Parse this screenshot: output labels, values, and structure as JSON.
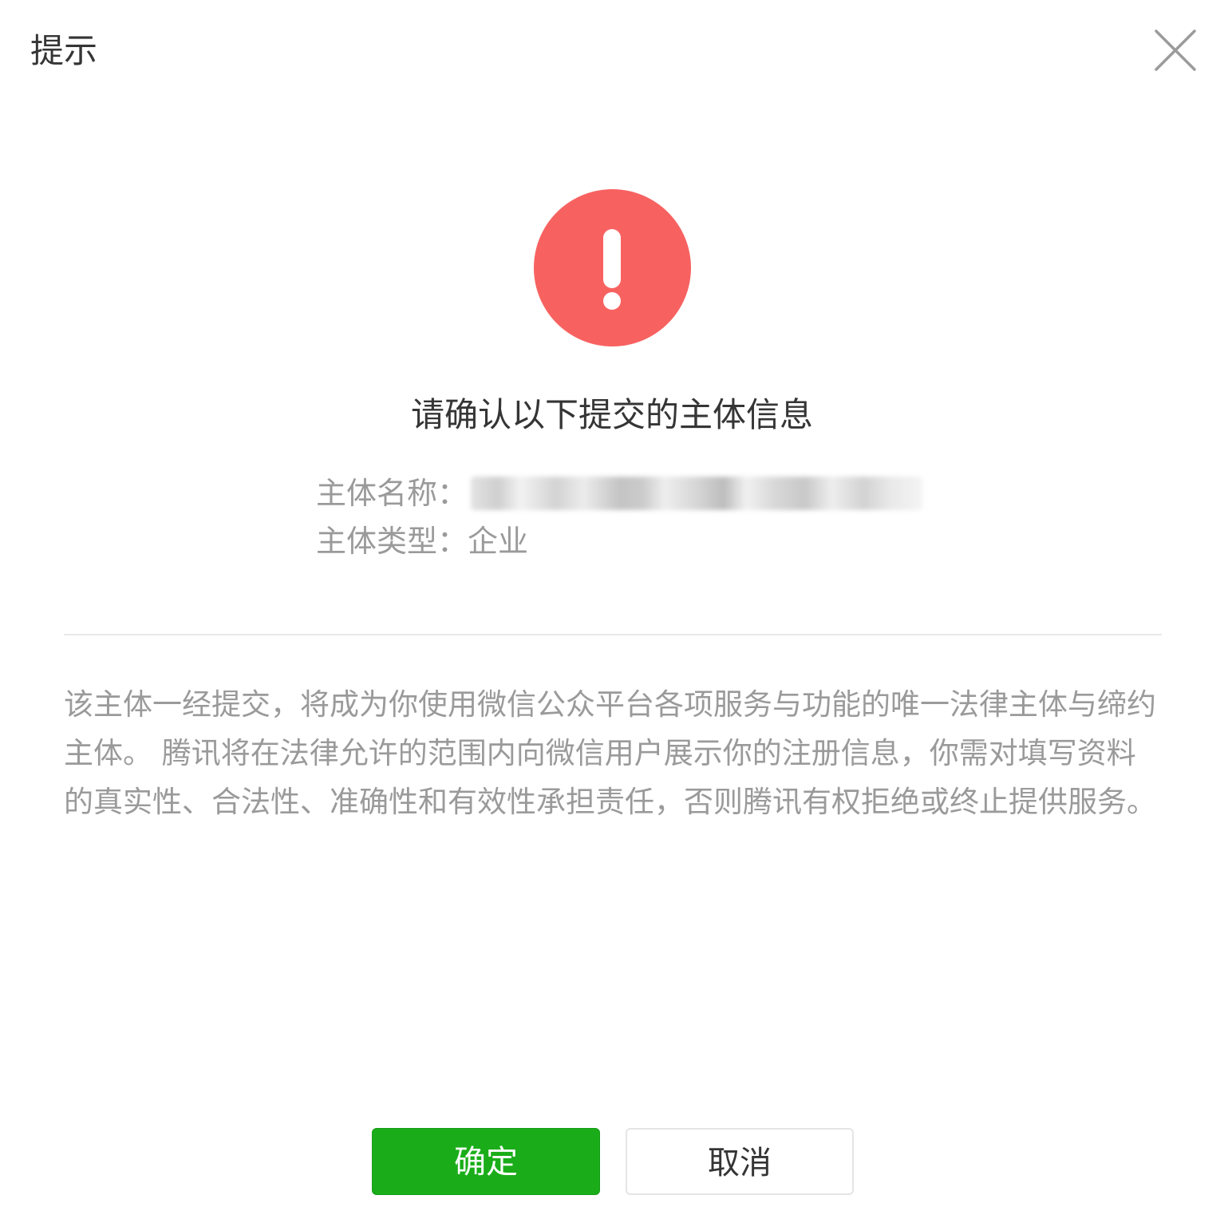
{
  "dialog": {
    "title": "提示",
    "close_icon": "close-icon",
    "warning_icon": "exclamation-icon",
    "warning_color": "#f76260",
    "headline": "请确认以下提交的主体信息",
    "entity_name_label": "主体名称：",
    "entity_type_label": "主体类型：",
    "entity_type_value": "企业",
    "notice": "该主体一经提交，将成为你使用微信公众平台各项服务与功能的唯一法律主体与缔约主体。 腾讯将在法律允许的范围内向微信用户展示你的注册信息，你需对填写资料的真实性、合法性、准确性和有效性承担责任，否则腾讯有权拒绝或终止提供服务。",
    "confirm_label": "确定",
    "cancel_label": "取消",
    "primary_color": "#1aad19"
  }
}
